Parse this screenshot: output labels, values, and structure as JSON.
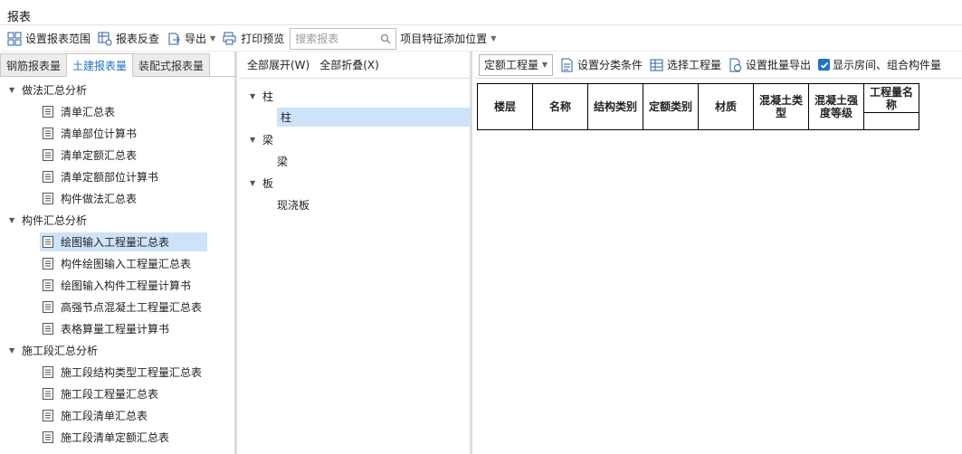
{
  "window": {
    "title": "报表"
  },
  "toolbar": {
    "set_range": "设置报表范围",
    "reverse_check": "报表反查",
    "export": "导出",
    "print_preview": "打印预览",
    "search_placeholder": "搜索报表",
    "feature_position": "项目特征添加位置"
  },
  "left": {
    "tabs": [
      "钢筋报表量",
      "土建报表量",
      "装配式报表量"
    ],
    "active_tab": "土建报表量",
    "groups": [
      {
        "label": "做法汇总分析",
        "items": [
          "清单汇总表",
          "清单部位计算书",
          "清单定额汇总表",
          "清单定额部位计算书",
          "构件做法汇总表"
        ]
      },
      {
        "label": "构件汇总分析",
        "items": [
          "绘图输入工程量汇总表",
          "构件绘图输入工程量汇总表",
          "绘图输入构件工程量计算书",
          "高强节点混凝土工程量汇总表",
          "表格算量工程量计算书"
        ]
      },
      {
        "label": "施工段汇总分析",
        "items": [
          "施工段结构类型工程量汇总表",
          "施工段工程量汇总表",
          "施工段清单汇总表",
          "施工段清单定额汇总表"
        ]
      }
    ],
    "selected_item": "绘图输入工程量汇总表"
  },
  "middle": {
    "expand_all": "全部展开(W)",
    "collapse_all": "全部折叠(X)",
    "tree": [
      {
        "label": "柱",
        "child": "柱"
      },
      {
        "label": "梁",
        "child": "梁"
      },
      {
        "label": "板",
        "child": "现浇板"
      }
    ],
    "selected_child": "柱"
  },
  "right": {
    "dropdown_value": "定额工程量",
    "set_classify": "设置分类条件",
    "select_quantity": "选择工程量",
    "batch_export": "设置批量导出",
    "show_rooms_checkbox": "显示房间、组合构件量",
    "show_rooms_checked": true,
    "table_headers": [
      "楼层",
      "名称",
      "结构类别",
      "定额类别",
      "材质",
      "混凝土类型",
      "混凝土强度等级",
      "工程量名称"
    ]
  },
  "colors": {
    "accent": "#1e73c8",
    "selection": "#cde3fa"
  }
}
